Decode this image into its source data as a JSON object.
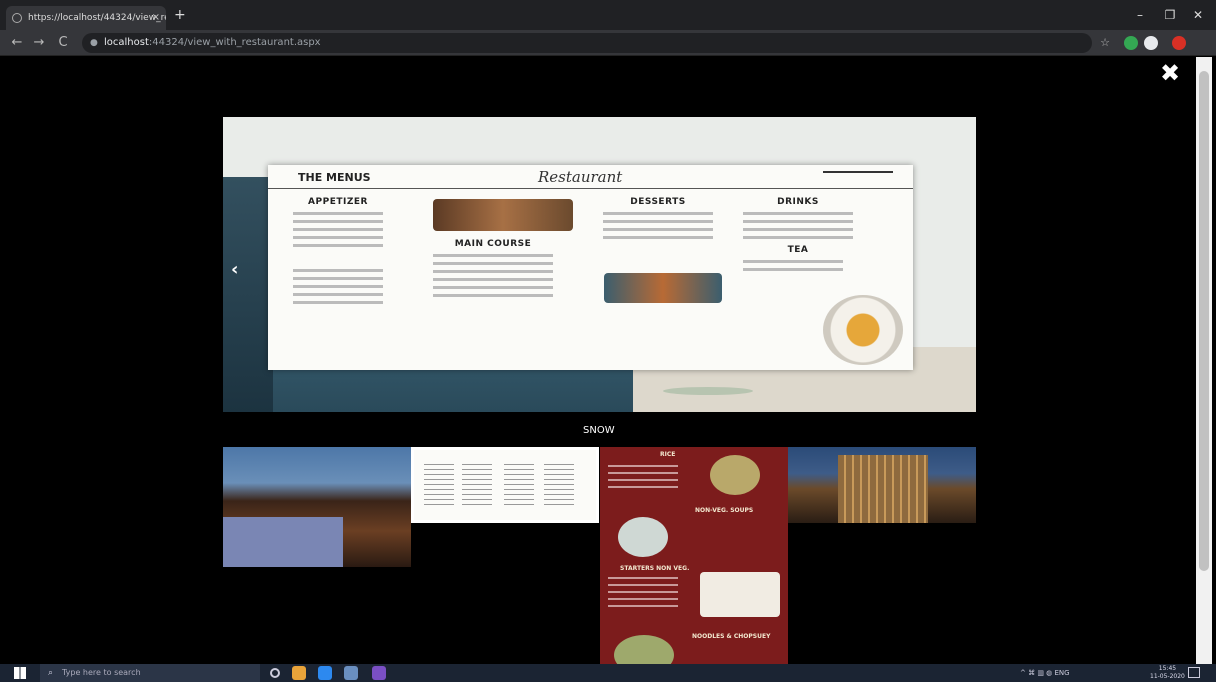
{
  "browser": {
    "tab_title": "https://localhost/44324/view_rest...",
    "tab_close": "×",
    "new_tab": "+",
    "window_controls": {
      "minimize": "–",
      "maximize": "❐",
      "close": "✕"
    },
    "nav": {
      "back": "←",
      "forward": "→",
      "reload": "C"
    },
    "url_host": "localhost",
    "url_path": ":44324/view_with_restaurant.aspx"
  },
  "lightbox": {
    "close_glyph": "✖",
    "prev_glyph": "‹",
    "caption": "SNOW",
    "main_image": {
      "menu_brand": "THE MENUS",
      "menu_title": "Restaurant",
      "sections": [
        "APPETIZER",
        "MAIN COURSE",
        "DESSERTS",
        "DRINKS",
        "TEA"
      ]
    },
    "thumbnails": [
      {
        "id": "thumb-resort"
      },
      {
        "id": "thumb-menu-card",
        "selected": true
      },
      {
        "id": "thumb-red-menu",
        "headings": [
          "RICE",
          "NON-VEG. SOUPS",
          "STARTERS NON VEG.",
          "NOODLES & CHOPSUEY"
        ]
      },
      {
        "id": "thumb-hotel-building"
      }
    ]
  },
  "taskbar": {
    "search_placeholder": "Type here to search",
    "search_glyph": "⌕",
    "tray_text": "^  ⌘  ▥  ◍  ENG",
    "time": "15:45",
    "date": "11-05-2020"
  },
  "colors": {
    "page_bg": "#000000",
    "chrome_dark": "#202124",
    "chrome_mid": "#35363a",
    "taskbar": "#1b2433",
    "red_menu": "#7c1c1c"
  }
}
